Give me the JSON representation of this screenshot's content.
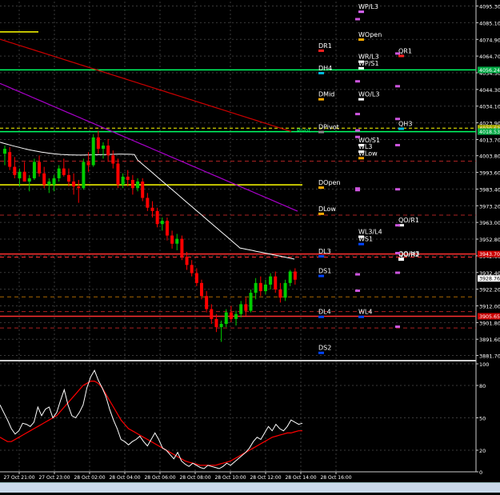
{
  "colors": {
    "background": "#000000",
    "grid": "#3a3a3a",
    "bull": "#00cc00",
    "bear": "#ff0000",
    "ma_fast": "#ffffff",
    "ma_mid": "#cc0000",
    "ma_slow": "#aa00cc",
    "pivot_yellow": "#ffff00",
    "pivot_green": "#00ff66",
    "level_red": "#ff3030",
    "rsi_fast": "#ffffff",
    "rsi_slow": "#ff0000"
  },
  "chart_data": [
    {
      "type": "candlestick",
      "price_axis": {
        "ylim": [
          3879,
          4098
        ],
        "ticks": [
          "4095.30",
          "4085.10",
          "4074.90",
          "4064.70",
          "4054.50",
          "4044.30",
          "4034.10",
          "4023.90",
          "4013.70",
          "4003.80",
          "3993.60",
          "3983.40",
          "3973.20",
          "3963.00",
          "3952.80",
          "3942.60",
          "3932.40",
          "3922.20",
          "3912.00",
          "3901.80",
          "3891.60",
          "3881.70"
        ],
        "price_labels": [
          {
            "text": "4056.24",
            "value": 4056.24,
            "color": "#00aa44"
          },
          {
            "text": "4020.63",
            "value": 4020.63,
            "color": "#aaaa00"
          },
          {
            "text": "4018.53",
            "value": 4018.53,
            "color": "#00aa44"
          },
          {
            "text": "3943.70",
            "value": 3943.7,
            "color": "#cc0000"
          },
          {
            "text": "3928.76",
            "value": 3928.76,
            "color": "#ffffff"
          },
          {
            "text": "3905.65",
            "value": 3905.65,
            "color": "#cc0000"
          }
        ]
      },
      "time_axis": {
        "labels": [
          "27 Oct 21:00",
          "27 Oct 23:00",
          "28 Oct 02:00",
          "28 Oct 04:00",
          "28 Oct 06:00",
          "28 Oct 08:00",
          "28 Oct 10:00",
          "28 Oct 12:00",
          "28 Oct 14:00",
          "28 Oct 16:00"
        ]
      },
      "candles": [
        [
          4005,
          4010,
          3998,
          4008
        ],
        [
          4006,
          4009,
          3995,
          3997
        ],
        [
          3997,
          4003,
          3990,
          3992
        ],
        [
          3990,
          3996,
          3985,
          3994
        ],
        [
          3994,
          4000,
          3988,
          3988
        ],
        [
          3988,
          3992,
          3982,
          3990
        ],
        [
          3990,
          4002,
          3989,
          4000
        ],
        [
          4000,
          4004,
          3991,
          3993
        ],
        [
          3993,
          3997,
          3984,
          3986
        ],
        [
          3986,
          3990,
          3981,
          3988
        ],
        [
          3986,
          3992,
          3982,
          3990
        ],
        [
          3990,
          3998,
          3988,
          3996
        ],
        [
          3996,
          4002,
          3991,
          3992
        ],
        [
          3992,
          3996,
          3985,
          3988
        ],
        [
          3988,
          3993,
          3980,
          3985
        ],
        [
          3985,
          3989,
          3975,
          3984
        ],
        [
          3984,
          4002,
          3983,
          4000
        ],
        [
          4000,
          4006,
          3994,
          3998
        ],
        [
          3998,
          4017,
          3997,
          4015
        ],
        [
          4015,
          4019,
          4005,
          4008
        ],
        [
          4008,
          4012,
          4002,
          4010
        ],
        [
          4010,
          4014,
          4000,
          4004
        ],
        [
          4004,
          4007,
          3996,
          3999
        ],
        [
          3999,
          4002,
          3984,
          3986
        ],
        [
          3986,
          3993,
          3984,
          3991
        ],
        [
          3991,
          3995,
          3985,
          3989
        ],
        [
          3989,
          3992,
          3980,
          3984
        ],
        [
          3984,
          3990,
          3982,
          3988
        ],
        [
          3988,
          3990,
          3976,
          3978
        ],
        [
          3978,
          3981,
          3970,
          3972
        ],
        [
          3972,
          3976,
          3966,
          3970
        ],
        [
          3970,
          3972,
          3960,
          3962
        ],
        [
          3962,
          3966,
          3958,
          3964
        ],
        [
          3964,
          3966,
          3952,
          3955
        ],
        [
          3955,
          3958,
          3947,
          3950
        ],
        [
          3950,
          3956,
          3946,
          3953
        ],
        [
          3953,
          3955,
          3940,
          3942
        ],
        [
          3942,
          3945,
          3934,
          3937
        ],
        [
          3937,
          3940,
          3930,
          3932
        ],
        [
          3932,
          3935,
          3924,
          3926
        ],
        [
          3926,
          3928,
          3916,
          3918
        ],
        [
          3918,
          3921,
          3908,
          3910
        ],
        [
          3910,
          3913,
          3901,
          3904
        ],
        [
          3904,
          3907,
          3896,
          3899
        ],
        [
          3899,
          3903,
          3890,
          3901
        ],
        [
          3901,
          3910,
          3899,
          3908
        ],
        [
          3908,
          3912,
          3902,
          3904
        ],
        [
          3904,
          3909,
          3900,
          3907
        ],
        [
          3907,
          3915,
          3905,
          3913
        ],
        [
          3913,
          3917,
          3906,
          3909
        ],
        [
          3909,
          3922,
          3908,
          3920
        ],
        [
          3920,
          3929,
          3916,
          3926
        ],
        [
          3926,
          3930,
          3918,
          3921
        ],
        [
          3921,
          3928,
          3919,
          3925
        ],
        [
          3925,
          3932,
          3922,
          3930
        ],
        [
          3930,
          3933,
          3920,
          3922
        ],
        [
          3922,
          3926,
          3914,
          3917
        ],
        [
          3917,
          3928,
          3915,
          3926
        ],
        [
          3926,
          3934,
          3924,
          3933
        ],
        [
          3933,
          3935,
          3925,
          3928
        ]
      ],
      "levels": [
        {
          "label": "DR1",
          "value": 4069.2,
          "color": "#ff2020",
          "label_col": "d"
        },
        {
          "label": "DH4",
          "value": 4055.5,
          "color": "#00bbdd",
          "label_col": "d"
        },
        {
          "label": "DMid",
          "value": 4039.5,
          "color": "#ffaa00",
          "label_col": "d"
        },
        {
          "label": "DPivot",
          "value": 4019.5,
          "color": "#888888",
          "label_col": "d"
        },
        {
          "label": "DOpen",
          "value": 3985.5,
          "color": "#ffaa00",
          "label_col": "d"
        },
        {
          "label": "DLow",
          "value": 3969.5,
          "color": "#ffaa00",
          "label_col": "d"
        },
        {
          "label": "DL3",
          "value": 3943.5,
          "color": "#0044ff",
          "label_col": "d"
        },
        {
          "label": "DS1",
          "value": 3931.5,
          "color": "#0044ff",
          "label_col": "d"
        },
        {
          "label": "DL4",
          "value": 3906.5,
          "color": "#0044ff",
          "label_col": "d"
        },
        {
          "label": "DS2",
          "value": 3884.5,
          "color": "#0044ff",
          "label_col": "d"
        },
        {
          "label": "WP/L3",
          "value": 4093.0,
          "color": "#dd66ff",
          "label_col": "w"
        },
        {
          "label": "WOpen",
          "value": 4076.0,
          "color": "#ffaa00",
          "label_col": "w"
        },
        {
          "label": "WR/L3",
          "value": 4062.5,
          "color": "#ffffff",
          "label_col": "w"
        },
        {
          "label": "WP/S1",
          "value": 4058.5,
          "color": "#ffffff",
          "label_col": "w"
        },
        {
          "label": "WO/L3",
          "value": 4039.5,
          "color": "#ffffff",
          "label_col": "w"
        },
        {
          "label": "WO/S1",
          "value": 4011.5,
          "color": "#ffffff",
          "label_col": "w"
        },
        {
          "label": "WL3",
          "value": 4007.5,
          "color": "#ffffff",
          "label_col": "w"
        },
        {
          "label": "WLow",
          "value": 4003.5,
          "color": "#ffaa00",
          "label_col": "w"
        },
        {
          "label": "WL3/L4",
          "value": 3955.5,
          "color": "#ffffff",
          "label_col": "w"
        },
        {
          "label": "WS1",
          "value": 3951.0,
          "color": "#0044ff",
          "label_col": "w"
        },
        {
          "label": "WL4",
          "value": 3906.5,
          "color": "#0044ff",
          "label_col": "w"
        },
        {
          "label": "QR1",
          "value": 4066.0,
          "color": "#ff2020",
          "label_col": "q"
        },
        {
          "label": "QH3",
          "value": 4021.5,
          "color": "#00bbdd",
          "label_col": "q"
        },
        {
          "label": "QO/R1",
          "value": 3962.5,
          "color": "#ffffff",
          "label_col": "q"
        },
        {
          "label": "QO/H3",
          "value": 3942.0,
          "color": "#ffffff",
          "label_col": "q"
        },
        {
          "label": "QO/R2",
          "value": 3941.5,
          "color": "#ffffff",
          "label_col": "q"
        }
      ],
      "pivot_tag": "Pivot",
      "rsi": {
        "ylim": [
          0,
          100
        ],
        "ticks": [
          "100",
          "80",
          "50",
          "20",
          "0"
        ],
        "fast": [
          62,
          55,
          48,
          40,
          35,
          38,
          45,
          44,
          42,
          46,
          60,
          52,
          58,
          60,
          50,
          55,
          66,
          76,
          62,
          52,
          50,
          55,
          62,
          78,
          88,
          94,
          85,
          78,
          70,
          58,
          48,
          40,
          30,
          28,
          25,
          28,
          30,
          33,
          28,
          24,
          30,
          36,
          30,
          22,
          20,
          16,
          12,
          18,
          10,
          7,
          5,
          8,
          6,
          4,
          3,
          6,
          5,
          4,
          3,
          5,
          8,
          6,
          9,
          12,
          15,
          18,
          22,
          28,
          32,
          30,
          36,
          42,
          38,
          44,
          40,
          38,
          42,
          48,
          46,
          44,
          45
        ],
        "slow": [
          32,
          30,
          28,
          28,
          30,
          32,
          34,
          36,
          38,
          40,
          42,
          44,
          46,
          48,
          50,
          52,
          56,
          60,
          64,
          68,
          72,
          76,
          80,
          82,
          84,
          84,
          82,
          78,
          72,
          66,
          60,
          54,
          48,
          44,
          40,
          38,
          36,
          34,
          32,
          30,
          28,
          26,
          24,
          22,
          20,
          18,
          16,
          14,
          12,
          10,
          9,
          8,
          7,
          6,
          6,
          6,
          6,
          6,
          7,
          8,
          9,
          10,
          12,
          14,
          16,
          18,
          20,
          22,
          24,
          26,
          28,
          30,
          32,
          33,
          34,
          35,
          36,
          36,
          37,
          38,
          38
        ]
      }
    }
  ]
}
